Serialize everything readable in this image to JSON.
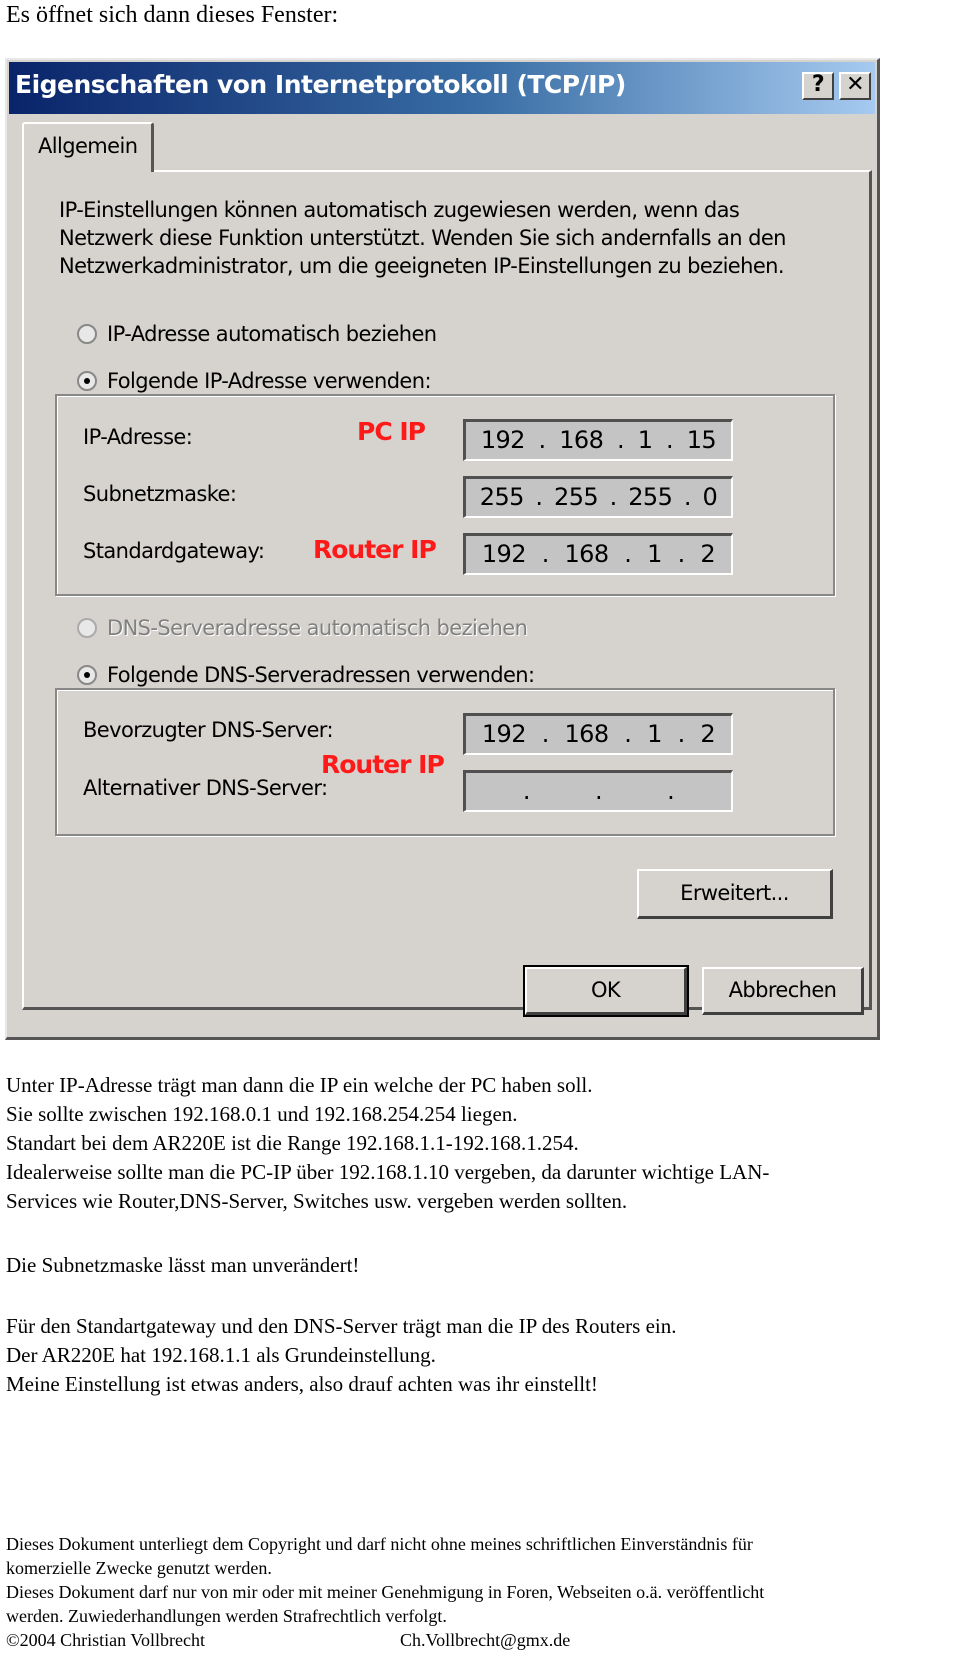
{
  "intro": "Es öffnet sich dann dieses Fenster:",
  "dialog": {
    "title": "Eigenschaften von Internetprotokoll (TCP/IP)",
    "help_button": "?",
    "close_button": "✕",
    "tab": "Allgemein",
    "description": "IP-Einstellungen können automatisch zugewiesen werden, wenn das Netzwerk diese Funktion unterstützt. Wenden Sie sich andernfalls an den Netzwerkadministrator, um die geeigneten IP-Einstellungen zu beziehen.",
    "radio_ip_auto": {
      "label": "IP-Adresse automatisch beziehen",
      "checked": false
    },
    "radio_ip_manual": {
      "label": "Folgende IP-Adresse verwenden:",
      "checked": true
    },
    "ip_fields": [
      {
        "label": "IP-Adresse:",
        "octets": [
          "192",
          "168",
          "1",
          "15"
        ]
      },
      {
        "label": "Subnetzmaske:",
        "octets": [
          "255",
          "255",
          "255",
          "0"
        ]
      },
      {
        "label": "Standardgateway:",
        "octets": [
          "192",
          "168",
          "1",
          "2"
        ]
      }
    ],
    "radio_dns_auto": {
      "label": "DNS-Serveradresse automatisch beziehen",
      "checked": false,
      "disabled": true
    },
    "radio_dns_manual": {
      "label": "Folgende DNS-Serveradressen verwenden:",
      "checked": true
    },
    "dns_fields": [
      {
        "label": "Bevorzugter DNS-Server:",
        "octets": [
          "192",
          "168",
          "1",
          "2"
        ]
      },
      {
        "label": "Alternativer DNS-Server:",
        "octets": [
          "",
          "",
          "",
          ""
        ]
      }
    ],
    "advanced_button": "Erweitert...",
    "ok_button": "OK",
    "cancel_button": "Abbrechen"
  },
  "annotations": {
    "pc_ip": "PC IP",
    "router_ip_gateway": "Router IP",
    "router_ip_dns": "Router IP",
    "color": "#ff1a1a"
  },
  "paragraphs": [
    [
      "Unter IP-Adresse trägt man dann die IP ein welche der PC haben soll.",
      "Sie sollte zwischen 192.168.0.1 und 192.168.254.254 liegen.",
      "Standart bei dem AR220E ist die Range 192.168.1.1-192.168.1.254.",
      "Idealerweise sollte man die PC-IP über 192.168.1.10 vergeben, da darunter wichtige LAN-",
      "Services wie Router,DNS-Server, Switches usw. vergeben werden sollten."
    ],
    [
      "Die Subnetzmaske lässt man unverändert!"
    ],
    [
      "Für den Standartgateway und den DNS-Server trägt man die IP des Routers ein.",
      "Der AR220E hat 192.168.1.1 als Grundeinstellung.",
      "Meine Einstellung ist etwas anders, also drauf achten was ihr einstellt!"
    ]
  ],
  "footer": {
    "lines": [
      "Dieses Dokument unterliegt dem Copyright und darf nicht ohne meines schriftlichen Einverständnis für",
      "komerzielle Zwecke genutzt werden.",
      "Dieses Dokument darf nur von mir oder mit meiner Genehmigung in Foren, Webseiten o.ä. veröffentlicht",
      "werden. Zuwiederhandlungen werden Strafrechtlich verfolgt."
    ],
    "copyright": "©2004 Christian Vollbrecht",
    "email": "Ch.Vollbrecht@gmx.de"
  }
}
